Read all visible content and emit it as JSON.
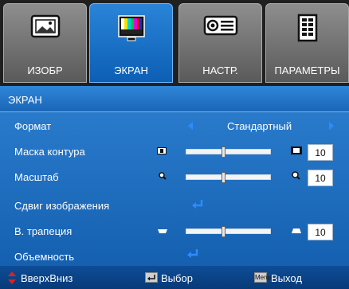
{
  "tabs": [
    {
      "label": "ИЗОБР",
      "icon": "picture-icon",
      "active": false
    },
    {
      "label": "ЭКРАН",
      "icon": "display-icon",
      "active": true
    },
    {
      "label": "НАСТР.",
      "icon": "projector-icon",
      "active": false
    },
    {
      "label": "ПАРАМЕТРЫ",
      "icon": "options-icon",
      "active": false
    }
  ],
  "panel": {
    "title": "ЭКРАН",
    "rows": {
      "format": {
        "label": "Формат",
        "value": "Стандартный"
      },
      "overscan": {
        "label": "Маска контура",
        "value": "10",
        "level": 0.44
      },
      "zoom": {
        "label": "Масштаб",
        "value": "10",
        "level": 0.44
      },
      "shift": {
        "label": "Сдвиг изображения"
      },
      "keystone": {
        "label": "В. трапеция",
        "value": "10",
        "level": 0.44
      },
      "three_d": {
        "label": "Объемность"
      }
    }
  },
  "footer": {
    "nav_label": "ВверхВниз",
    "select_label": "Выбор",
    "menu_key": "Menu",
    "exit_label": "Выход"
  },
  "colors": {
    "active_tab": "#1a72c8",
    "panel_bg": "#2d7fd0",
    "footer_bg": "#0d4d97",
    "arrow": "#2e8bff"
  }
}
